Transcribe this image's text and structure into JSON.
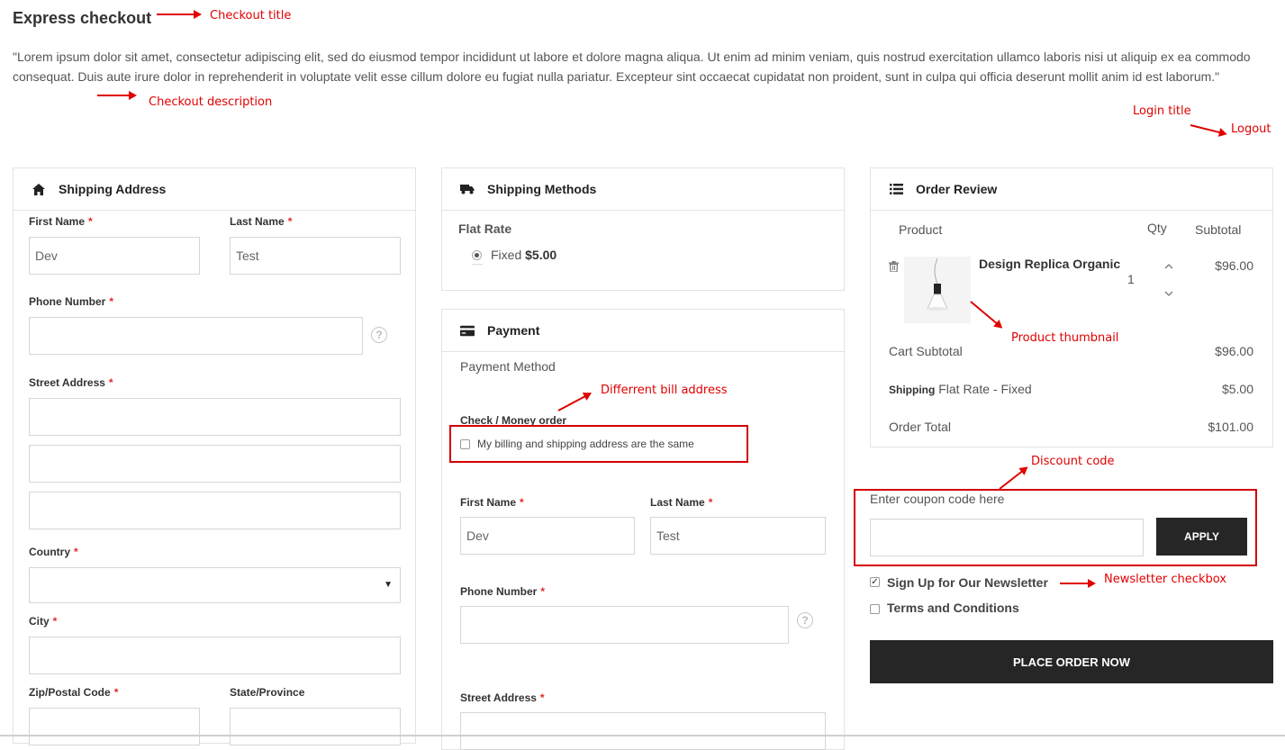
{
  "page": {
    "title": "Express checkout",
    "description": "\"Lorem ipsum dolor sit amet, consectetur adipiscing elit, sed do eiusmod tempor incididunt ut labore et dolore magna aliqua. Ut enim ad minim veniam, quis nostrud exercitation ullamco laboris nisi ut aliquip ex ea commodo consequat. Duis aute irure dolor in reprehenderit in voluptate velit esse cillum dolore eu fugiat nulla pariatur. Excepteur sint occaecat cupidatat non proident, sunt in culpa qui officia deserunt mollit anim id est laborum.\""
  },
  "annotations": {
    "checkout_title": "Checkout title",
    "checkout_description": "Checkout description",
    "login_title": "Login title",
    "logout": "Logout",
    "product_thumbnail": "Product thumbnail",
    "different_bill_address": "Differrent bill address",
    "discount_code": "Discount code",
    "newsletter_checkbox": "Newsletter checkbox"
  },
  "shipping_address": {
    "heading": "Shipping Address",
    "first_name_label": "First Name",
    "first_name_value": "Dev",
    "last_name_label": "Last Name",
    "last_name_value": "Test",
    "phone_label": "Phone Number",
    "street_label": "Street Address",
    "country_label": "Country",
    "city_label": "City",
    "zip_label": "Zip/Postal Code",
    "state_label": "State/Province",
    "required_mark": "*",
    "help_glyph": "?"
  },
  "shipping_methods": {
    "heading": "Shipping Methods",
    "carrier": "Flat Rate",
    "option_label": "Fixed",
    "option_price": "$5.00"
  },
  "payment": {
    "heading": "Payment",
    "method_label": "Payment Method",
    "method_name": "Check / Money order",
    "same_address_label": "My billing and shipping address are the same",
    "first_name_label": "First Name",
    "first_name_value": "Dev",
    "last_name_label": "Last Name",
    "last_name_value": "Test",
    "phone_label": "Phone Number",
    "street_label": "Street Address"
  },
  "order_review": {
    "heading": "Order Review",
    "col_product": "Product",
    "col_qty": "Qty",
    "col_subtotal": "Subtotal",
    "item_name": "Design Replica Organic",
    "item_qty": "1",
    "item_subtotal": "$96.00",
    "cart_subtotal_label": "Cart Subtotal",
    "cart_subtotal_value": "$96.00",
    "shipping_label_bold": "Shipping",
    "shipping_label_rest": "Flat Rate - Fixed",
    "shipping_value": "$5.00",
    "order_total_label": "Order Total",
    "order_total_value": "$101.00"
  },
  "coupon": {
    "label": "Enter coupon code here",
    "apply_label": "APPLY"
  },
  "options": {
    "newsletter_label": "Sign Up for Our Newsletter",
    "newsletter_checked": true,
    "terms_label": "Terms and Conditions"
  },
  "place_order_label": "PLACE ORDER NOW",
  "colors": {
    "annotation_red": "#e00000",
    "dark_button": "#262626",
    "required_red": "#e02b27"
  }
}
